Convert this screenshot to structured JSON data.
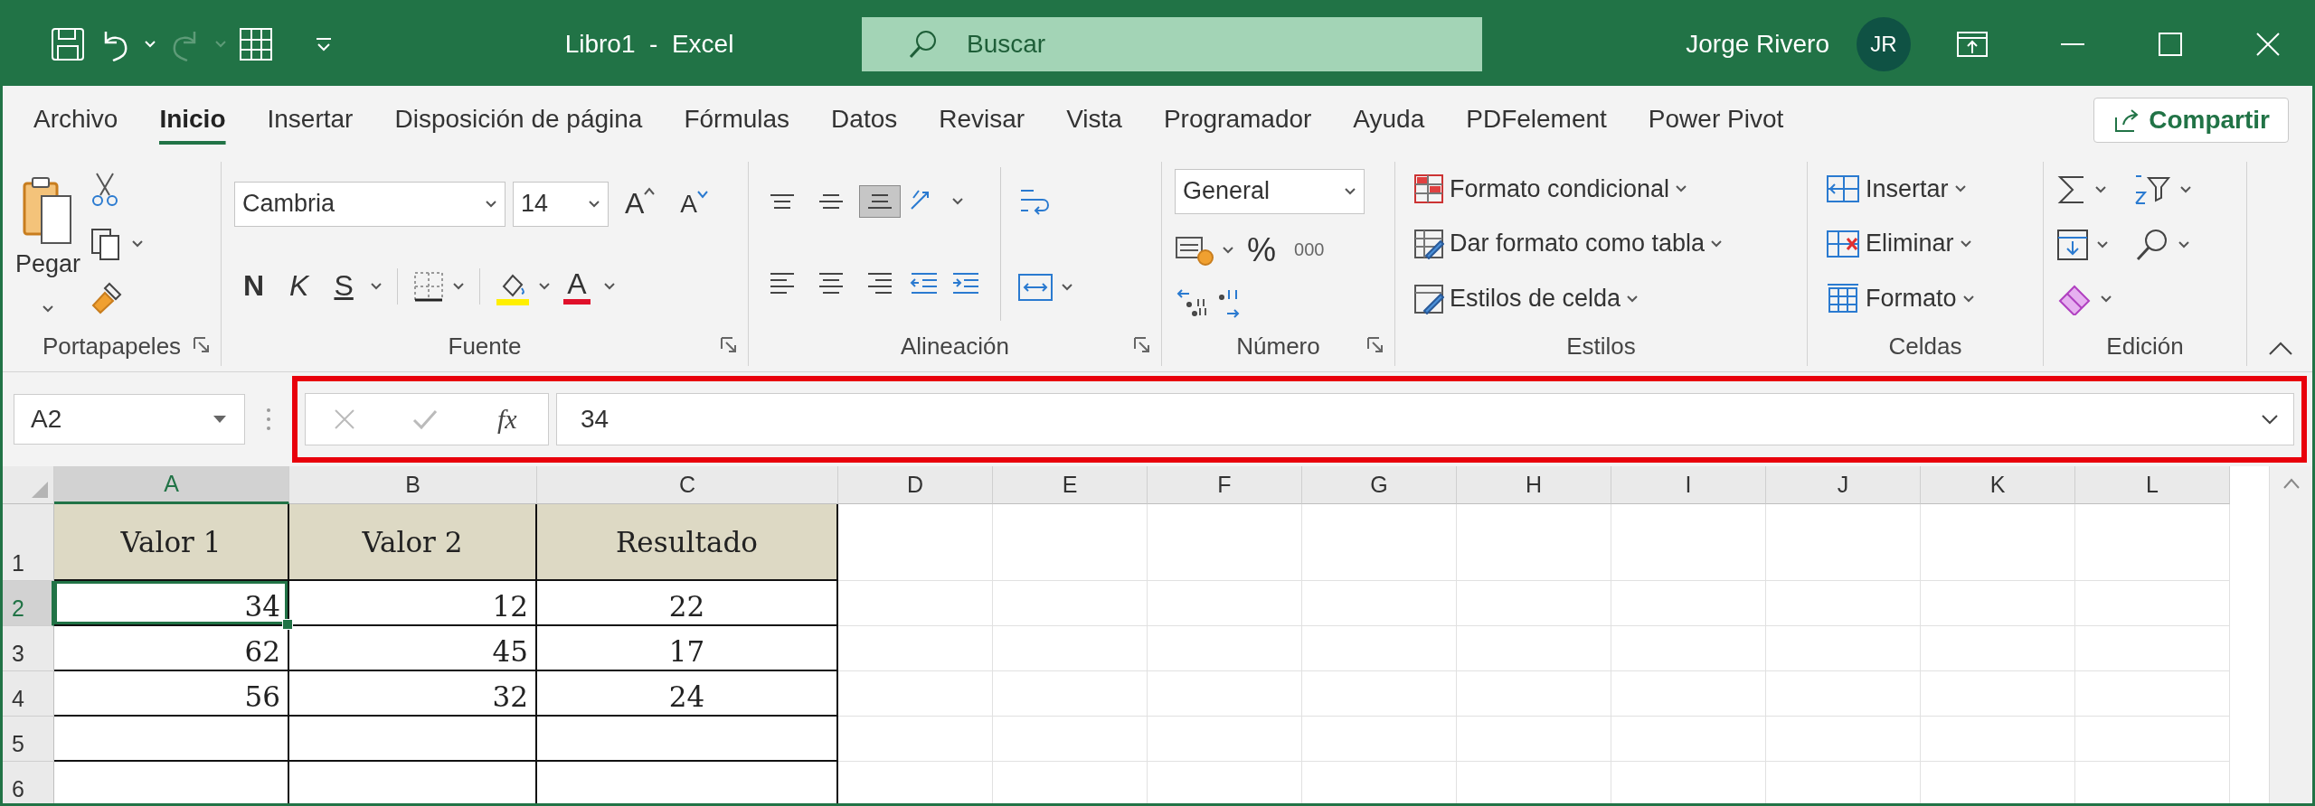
{
  "title_bar": {
    "title": "Libro1  -  Excel",
    "search": {
      "placeholder": "Buscar"
    },
    "user": {
      "name": "Jorge Rivero",
      "initials": "JR"
    }
  },
  "tabs": [
    {
      "label": "Archivo",
      "selected": false
    },
    {
      "label": "Inicio",
      "selected": true
    },
    {
      "label": "Insertar",
      "selected": false
    },
    {
      "label": "Disposición de página",
      "selected": false
    },
    {
      "label": "Fórmulas",
      "selected": false
    },
    {
      "label": "Datos",
      "selected": false
    },
    {
      "label": "Revisar",
      "selected": false
    },
    {
      "label": "Vista",
      "selected": false
    },
    {
      "label": "Programador",
      "selected": false
    },
    {
      "label": "Ayuda",
      "selected": false
    },
    {
      "label": "PDFelement",
      "selected": false
    },
    {
      "label": "Power Pivot",
      "selected": false
    }
  ],
  "share_button": {
    "label": "Compartir"
  },
  "ribbon": {
    "clipboard": {
      "paste_label": "Pegar",
      "label": "Portapapeles"
    },
    "font": {
      "font_name": "Cambria",
      "font_size": "14",
      "grow_label": "A",
      "shrink_label": "A",
      "bold_label": "N",
      "italic_label": "K",
      "underline_label": "S",
      "font_color_label": "A",
      "label": "Fuente"
    },
    "alignment": {
      "vertical_buttons": [
        {
          "kind": "top",
          "selected": false
        },
        {
          "kind": "middle",
          "selected": false
        },
        {
          "kind": "bottom",
          "selected": true
        }
      ],
      "horizontal_buttons": [
        {
          "kind": "left",
          "selected": false
        },
        {
          "kind": "center",
          "selected": false
        },
        {
          "kind": "right",
          "selected": false
        }
      ],
      "label": "Alineación"
    },
    "number": {
      "format": "General",
      "percent_label": "%",
      "thousands_label": "000",
      "label": "Número"
    },
    "styles": {
      "items": [
        {
          "kind": "conditional",
          "label": "Formato condicional"
        },
        {
          "kind": "table",
          "label": "Dar formato como tabla"
        },
        {
          "kind": "cell",
          "label": "Estilos de celda"
        }
      ],
      "label": "Estilos"
    },
    "cells": {
      "items": [
        {
          "kind": "insert",
          "label": "Insertar"
        },
        {
          "kind": "delete",
          "label": "Eliminar"
        },
        {
          "kind": "format",
          "label": "Formato"
        }
      ],
      "label": "Celdas"
    },
    "editing": {
      "label": "Edición"
    }
  },
  "formula_bar": {
    "name_box": "A2",
    "function_label": "fx",
    "value": "34",
    "highlighted": true
  },
  "sheet": {
    "columns": [
      {
        "label": "A",
        "selected": true
      },
      {
        "label": "B",
        "selected": false
      },
      {
        "label": "C",
        "selected": false
      },
      {
        "label": "D",
        "selected": false
      },
      {
        "label": "E",
        "selected": false
      },
      {
        "label": "F",
        "selected": false
      },
      {
        "label": "G",
        "selected": false
      },
      {
        "label": "H",
        "selected": false
      },
      {
        "label": "I",
        "selected": false
      },
      {
        "label": "J",
        "selected": false
      },
      {
        "label": "K",
        "selected": false
      },
      {
        "label": "L",
        "selected": false
      }
    ],
    "rows": [
      {
        "number": "1",
        "kind": "header",
        "selected": false,
        "cells": [
          {
            "text": "Valor 1",
            "selected": false
          },
          {
            "text": "Valor 2",
            "selected": false
          },
          {
            "text": "Resultado",
            "selected": false
          }
        ]
      },
      {
        "number": "2",
        "kind": "data",
        "selected": true,
        "cells": [
          {
            "text": "34",
            "selected": true
          },
          {
            "text": "12",
            "selected": false
          },
          {
            "text": "22",
            "selected": false
          }
        ]
      },
      {
        "number": "3",
        "kind": "data",
        "selected": false,
        "cells": [
          {
            "text": "62",
            "selected": false
          },
          {
            "text": "45",
            "selected": false
          },
          {
            "text": "17",
            "selected": false
          }
        ]
      },
      {
        "number": "4",
        "kind": "data",
        "selected": false,
        "cells": [
          {
            "text": "56",
            "selected": false
          },
          {
            "text": "32",
            "selected": false
          },
          {
            "text": "24",
            "selected": false
          }
        ]
      },
      {
        "number": "5",
        "kind": "data",
        "selected": false
      },
      {
        "number": "6",
        "kind": "data",
        "selected": false
      }
    ]
  }
}
